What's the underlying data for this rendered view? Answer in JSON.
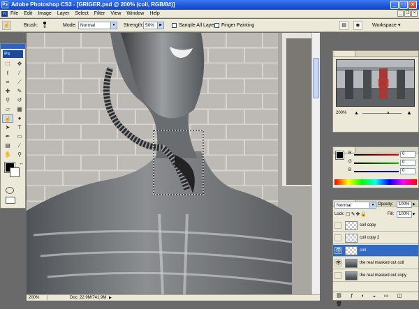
{
  "window": {
    "title": "Adobe Photoshop CS3 - [GRIGER.psd @ 200% (coil, RGB/8#)]",
    "minimize": "_",
    "maximize": "□",
    "close": "×"
  },
  "menu": [
    "File",
    "Edit",
    "Image",
    "Layer",
    "Select",
    "Filter",
    "View",
    "Window",
    "Help"
  ],
  "options": {
    "brush_label": "Brush:",
    "brush_size": "8",
    "mode_label": "Mode:",
    "mode_value": "Normal",
    "strength_label": "Strength:",
    "strength_value": "50%",
    "sample_all_layers": "Sample All Layers",
    "finger_painting": "Finger Painting",
    "workspace": "Workspace ▾"
  },
  "toolbox": {
    "logo": "Ps"
  },
  "status": {
    "zoom": "200%",
    "doc": "Doc: 22.9M/741.9M"
  },
  "navigator": {
    "zoom": "200%"
  },
  "color": {
    "r_label": "R",
    "g_label": "G",
    "b_label": "B",
    "r": "0",
    "g": "0",
    "b": "0"
  },
  "layers_panel": {
    "blend_mode": "Normal",
    "opacity_label": "Opacity:",
    "opacity": "100%",
    "lock_label": "Lock:",
    "fill_label": "Fill:",
    "fill": "100%",
    "layers": [
      {
        "name": "coil copy",
        "visible": false,
        "selected": false,
        "thumb": "checker"
      },
      {
        "name": "coil copy 2",
        "visible": false,
        "selected": false,
        "thumb": "checker"
      },
      {
        "name": "coil",
        "visible": true,
        "selected": true,
        "thumb": "checker"
      },
      {
        "name": "the real masked out coil",
        "visible": true,
        "selected": false,
        "thumb": "photo"
      },
      {
        "name": "the real masked out copy",
        "visible": false,
        "selected": false,
        "thumb": "photo"
      }
    ]
  },
  "colors": {
    "accent": "#316ac5",
    "titlebar": "#1b55d8",
    "ui_bg": "#ece9d8"
  }
}
